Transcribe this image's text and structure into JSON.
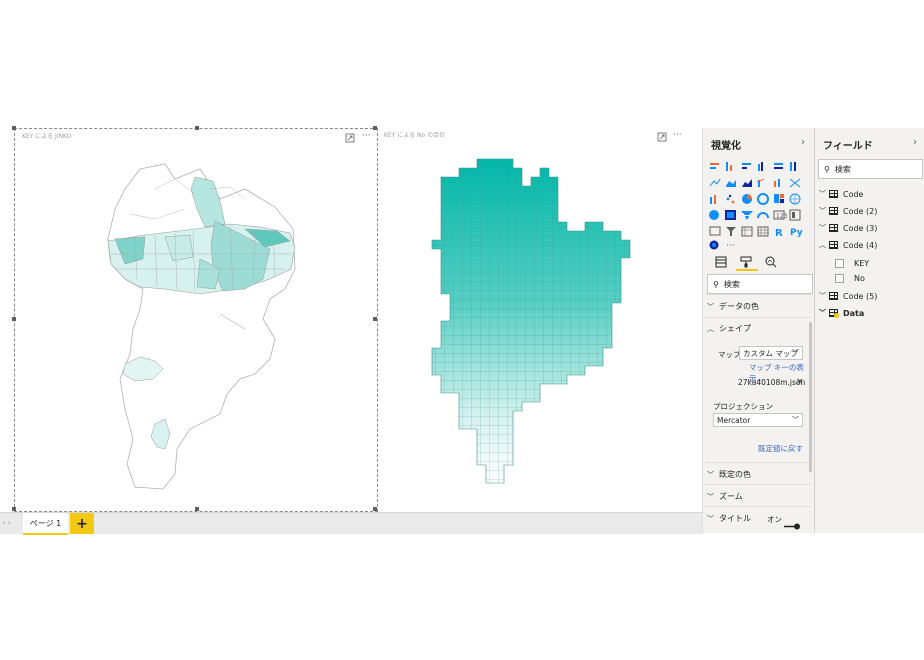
{
  "canvas": {
    "visual1": {
      "title": "KEY による JINKO"
    },
    "visual2": {
      "title": "KEY による No の合計"
    },
    "focus_icon": "focus-mode-icon",
    "more_icon": "more-options-icon"
  },
  "tabs": {
    "pages": [
      {
        "label": "ページ 1"
      }
    ],
    "add_label": "+"
  },
  "viz_pane": {
    "title": "視覚化",
    "chevron": "›",
    "more": "...",
    "search_placeholder": "検索",
    "sections": {
      "data_colors": "データの色",
      "shape": "シェイプ",
      "default_color": "既定の色",
      "zoom": "ズーム",
      "title": "タイトル"
    },
    "map_label": "マップ",
    "map_value": "カスタム マップ",
    "map_keys_link": "マップ キーの表示...",
    "file_name": "27ka40108m.json",
    "projection_label": "プロジェクション",
    "projection_value": "Mercator",
    "reset_link": "既定値に戻す",
    "title_toggle": "オン"
  },
  "fields_pane": {
    "title": "フィールド",
    "chevron": "›",
    "search_placeholder": "検索",
    "tables": [
      {
        "name": "Code"
      },
      {
        "name": "Code (2)"
      },
      {
        "name": "Code (3)"
      },
      {
        "name": "Code (4)",
        "fields": [
          "KEY",
          "No"
        ]
      },
      {
        "name": "Code (5)"
      },
      {
        "name": "Data"
      }
    ]
  },
  "colors": {
    "accent": "#f2c811",
    "teal": "#01b8aa",
    "pane_bg": "#f3f2f1",
    "link": "#3a67c7"
  }
}
